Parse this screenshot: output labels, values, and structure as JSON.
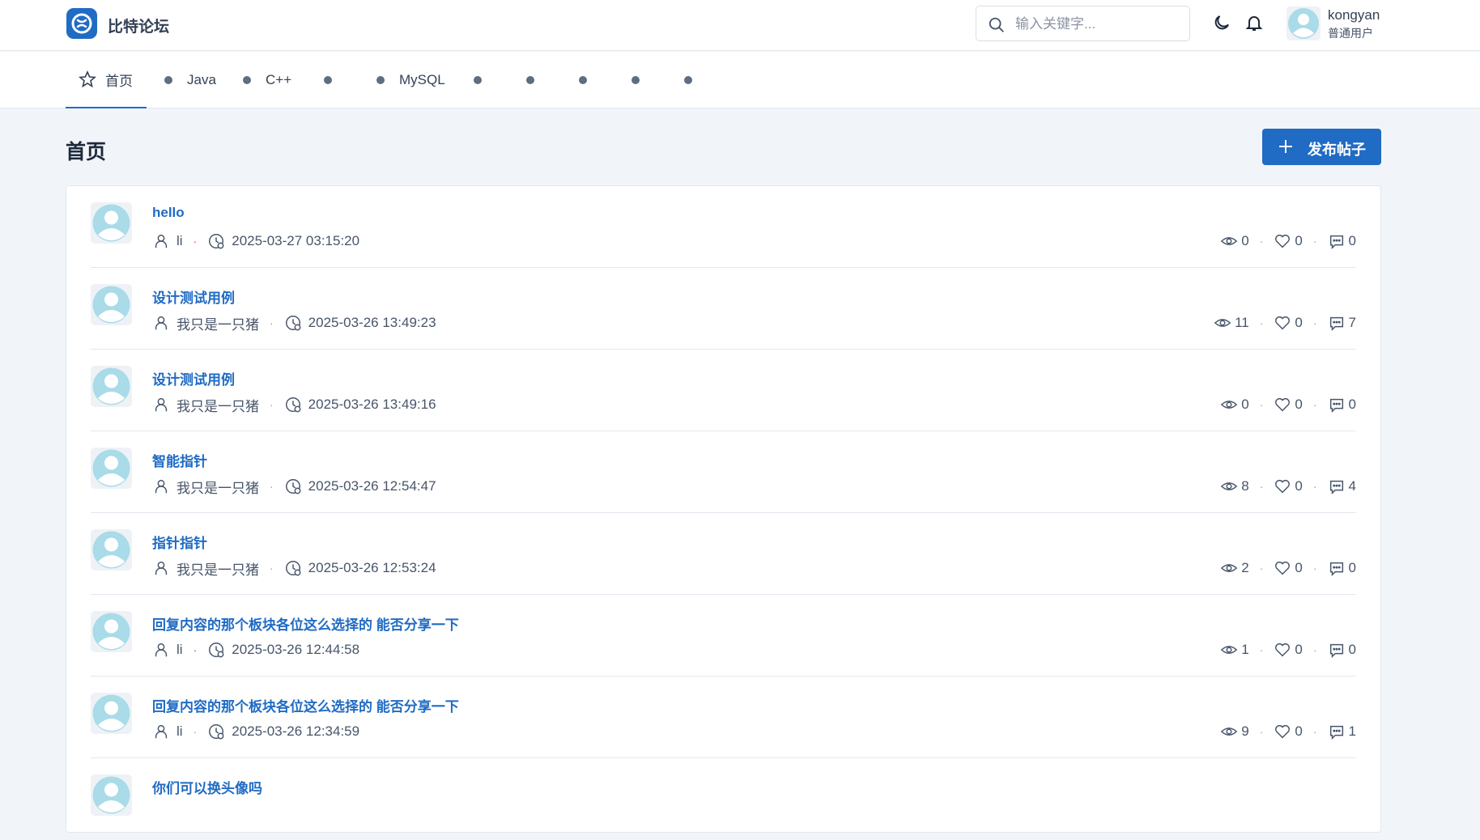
{
  "app": {
    "brand": "比特论坛",
    "search_placeholder": "输入关键字...",
    "user": {
      "name": "kongyan",
      "role": "普通用户"
    }
  },
  "nav": {
    "items": [
      {
        "label": "首页",
        "icon": "star-icon",
        "active": true
      },
      {
        "label": "Java",
        "icon": "dot"
      },
      {
        "label": "C++",
        "icon": "dot"
      },
      {
        "label": "",
        "icon": "dot"
      },
      {
        "label": "MySQL",
        "icon": "dot"
      },
      {
        "label": "",
        "icon": "dot"
      },
      {
        "label": "",
        "icon": "dot"
      },
      {
        "label": "",
        "icon": "dot"
      },
      {
        "label": "",
        "icon": "dot"
      },
      {
        "label": "",
        "icon": "dot"
      }
    ]
  },
  "page": {
    "title": "首页",
    "new_post_label": "发布帖子"
  },
  "colors": {
    "accent": "#206bc4",
    "meta_separator": "#d63939"
  },
  "posts": [
    {
      "title": "hello",
      "author": "li",
      "time": "2025-03-27 03:15:20",
      "views": "0",
      "likes": "0",
      "comments": "0"
    },
    {
      "title": "设计测试用例",
      "author": "我只是一只猪",
      "time": "2025-03-26 13:49:23",
      "views": "11",
      "likes": "0",
      "comments": "7"
    },
    {
      "title": "设计测试用例",
      "author": "我只是一只猪",
      "time": "2025-03-26 13:49:16",
      "views": "0",
      "likes": "0",
      "comments": "0"
    },
    {
      "title": "智能指针",
      "author": "我只是一只猪",
      "time": "2025-03-26 12:54:47",
      "views": "8",
      "likes": "0",
      "comments": "4"
    },
    {
      "title": "指针指针",
      "author": "我只是一只猪",
      "time": "2025-03-26 12:53:24",
      "views": "2",
      "likes": "0",
      "comments": "0"
    },
    {
      "title": "回复内容的那个板块各位这么选择的 能否分享一下",
      "author": "li",
      "time": "2025-03-26 12:44:58",
      "views": "1",
      "likes": "0",
      "comments": "0"
    },
    {
      "title": "回复内容的那个板块各位这么选择的 能否分享一下",
      "author": "li",
      "time": "2025-03-26 12:34:59",
      "views": "9",
      "likes": "0",
      "comments": "1"
    },
    {
      "title": "你们可以换头像吗",
      "author": "",
      "time": "",
      "views": "",
      "likes": "",
      "comments": ""
    }
  ]
}
